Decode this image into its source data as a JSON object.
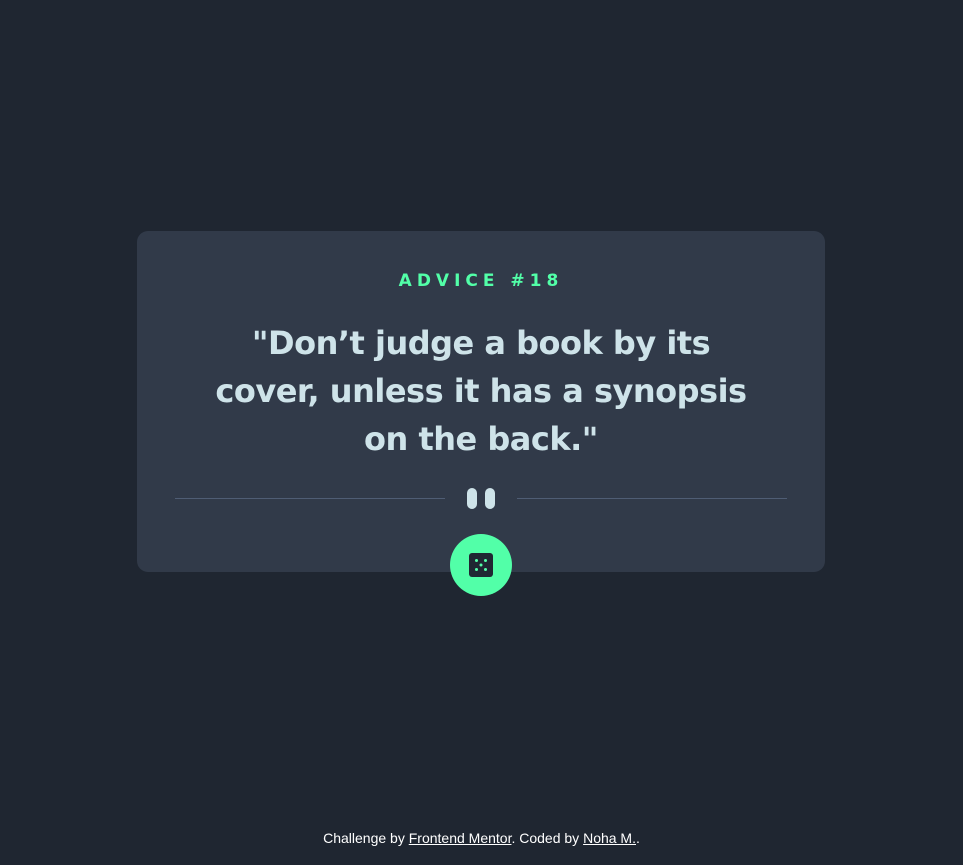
{
  "card": {
    "advice_id": "ADVICE #18",
    "quote": "\"Don’t judge a book by its cover, unless it has a synopsis on the back.\""
  },
  "divider": {
    "icon": "pause-icon"
  },
  "dice_button": {
    "icon": "dice-icon"
  },
  "footer": {
    "prefix": "Challenge by ",
    "frontend_mentor": "Frontend Mentor",
    "middle": ". Coded by ",
    "author": "Noha M.",
    "suffix": "."
  },
  "colors": {
    "background": "#1f2631",
    "card": "#313a49",
    "accent": "#52ffa8",
    "quote_text": "#cee3e9",
    "divider": "#4f5d74"
  }
}
